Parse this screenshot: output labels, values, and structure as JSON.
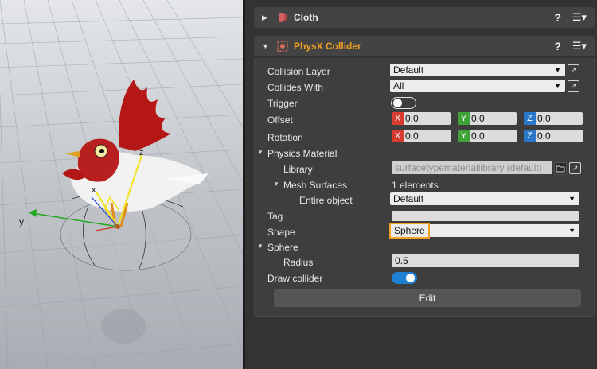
{
  "viewport": {
    "axis_y_label": "y",
    "axis_z_label": "z",
    "axis_x_label": "x"
  },
  "cloth": {
    "title": "Cloth",
    "help": "?",
    "icon": "cloth-icon"
  },
  "collider": {
    "title": "PhysX Collider",
    "help": "?",
    "icon": "physx-collider-icon",
    "collision_layer": {
      "label": "Collision Layer",
      "value": "Default"
    },
    "collides_with": {
      "label": "Collides With",
      "value": "All"
    },
    "trigger": {
      "label": "Trigger",
      "on": false
    },
    "offset": {
      "label": "Offset",
      "x": "0.0",
      "y": "0.0",
      "z": "0.0"
    },
    "rotation": {
      "label": "Rotation",
      "x": "0.0",
      "y": "0.0",
      "z": "0.0"
    },
    "physics_material": {
      "label": "Physics Material",
      "library_label": "Library",
      "library_value": "surfacetypemateriallibrary (default)",
      "mesh_surfaces_label": "Mesh Surfaces",
      "mesh_surfaces_value": "1 elements",
      "entire_object_label": "Entire object",
      "entire_object_value": "Default"
    },
    "tag": {
      "label": "Tag",
      "value": ""
    },
    "shape": {
      "label": "Shape",
      "value": "Sphere"
    },
    "sphere": {
      "label": "Sphere",
      "radius_label": "Radius",
      "radius_value": "0.5"
    },
    "draw_collider": {
      "label": "Draw collider",
      "on": true
    },
    "edit_label": "Edit"
  },
  "colors": {
    "axis_x": "#d83c30",
    "axis_y": "#3fa33a",
    "axis_z": "#2a78c9",
    "highlight": "#f0a022",
    "toggle_on": "#1f7fd0"
  }
}
